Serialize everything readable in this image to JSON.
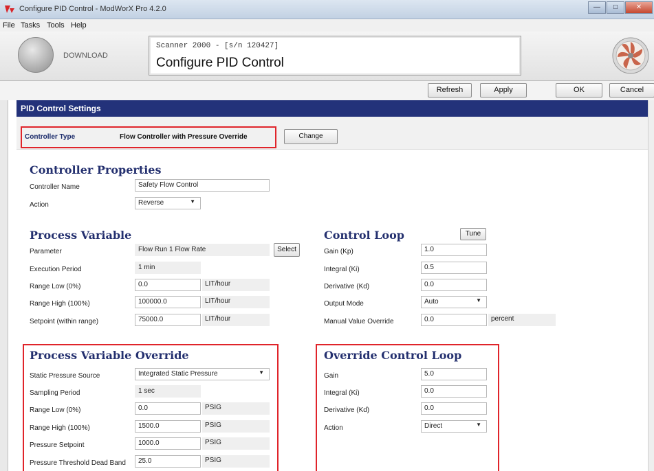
{
  "window": {
    "title": "Configure PID Control - ModWorX Pro 4.2.0",
    "minimize": "—",
    "maximize": "□",
    "close": "✕"
  },
  "menu": [
    "File",
    "Tasks",
    "Tools",
    "Help"
  ],
  "header": {
    "download_label": "DOWNLOAD",
    "scanner_line": "Scanner 2000 -  [s/n 120427]",
    "page_title": "Configure PID Control"
  },
  "toolbar": {
    "refresh": "Refresh",
    "apply": "Apply",
    "ok": "OK",
    "cancel": "Cancel"
  },
  "section_title": "PID Control Settings",
  "controller_type": {
    "label": "Controller Type",
    "value": "Flow Controller with Pressure Override",
    "change_button": "Change"
  },
  "controller_properties": {
    "heading": "Controller Properties",
    "name_label": "Controller Name",
    "name_value": "Safety Flow Control",
    "action_label": "Action",
    "action_value": "Reverse"
  },
  "process_variable": {
    "heading": "Process Variable",
    "parameter_label": "Parameter",
    "parameter_value": "Flow Run 1 Flow Rate",
    "select_button": "Select",
    "execution_label": "Execution Period",
    "execution_value": "1 min",
    "range_low_label": "Range Low (0%)",
    "range_low_value": "0.0",
    "range_low_unit": "LIT/hour",
    "range_high_label": "Range High (100%)",
    "range_high_value": "100000.0",
    "range_high_unit": "LIT/hour",
    "setpoint_label": "Setpoint (within range)",
    "setpoint_value": "75000.0",
    "setpoint_unit": "LIT/hour"
  },
  "control_loop": {
    "heading": "Control Loop",
    "tune_button": "Tune",
    "gain_label": "Gain (Kp)",
    "gain_value": "1.0",
    "integral_label": "Integral (Ki)",
    "integral_value": "0.5",
    "derivative_label": "Derivative (Kd)",
    "derivative_value": "0.0",
    "output_mode_label": "Output Mode",
    "output_mode_value": "Auto",
    "manual_label": "Manual Value Override",
    "manual_value": "0.0",
    "manual_unit": "percent"
  },
  "pv_override": {
    "heading": "Process Variable Override",
    "source_label": "Static Pressure Source",
    "source_value": "Integrated Static Pressure",
    "sampling_label": "Sampling Period",
    "sampling_value": "1 sec",
    "range_low_label": "Range Low (0%)",
    "range_low_value": "0.0",
    "range_low_unit": "PSIG",
    "range_high_label": "Range High (100%)",
    "range_high_value": "1500.0",
    "range_high_unit": "PSIG",
    "setpoint_label": "Pressure Setpoint",
    "setpoint_value": "1000.0",
    "setpoint_unit": "PSIG",
    "deadband_label": "Pressure Threshold Dead Band",
    "deadband_value": "25.0",
    "deadband_unit": "PSIG"
  },
  "override_loop": {
    "heading": "Override Control Loop",
    "gain_label": "Gain",
    "gain_value": "5.0",
    "integral_label": "Integral (Ki)",
    "integral_value": "0.0",
    "derivative_label": "Derivative (Kd)",
    "derivative_value": "0.0",
    "action_label": "Action",
    "action_value": "Direct"
  },
  "colors": {
    "banner": "#23327a",
    "heading": "#24306f",
    "highlight": "#e0242a"
  }
}
